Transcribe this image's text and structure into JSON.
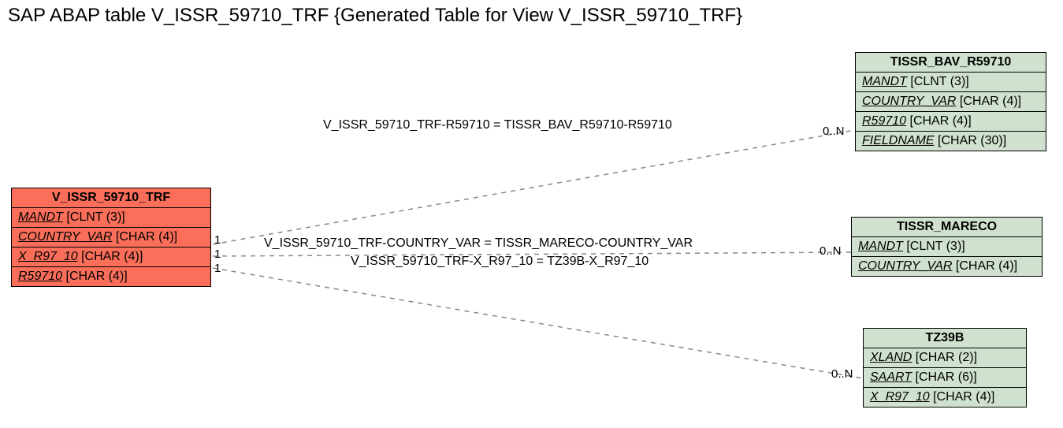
{
  "title": "SAP ABAP table V_ISSR_59710_TRF {Generated Table for View V_ISSR_59710_TRF}",
  "entities": {
    "main": {
      "name": "V_ISSR_59710_TRF",
      "fields": [
        {
          "key": "MANDT",
          "type": " [CLNT (3)]"
        },
        {
          "key": "COUNTRY_VAR",
          "type": " [CHAR (4)]"
        },
        {
          "key": "X_R97_10",
          "type": " [CHAR (4)]"
        },
        {
          "key": "R59710",
          "type": " [CHAR (4)]"
        }
      ]
    },
    "e1": {
      "name": "TISSR_BAV_R59710",
      "fields": [
        {
          "key": "MANDT",
          "type": " [CLNT (3)]"
        },
        {
          "key": "COUNTRY_VAR",
          "type": " [CHAR (4)]"
        },
        {
          "key": "R59710",
          "type": " [CHAR (4)]"
        },
        {
          "key": "FIELDNAME",
          "type": " [CHAR (30)]"
        }
      ]
    },
    "e2": {
      "name": "TISSR_MARECO",
      "fields": [
        {
          "key": "MANDT",
          "type": " [CLNT (3)]"
        },
        {
          "key": "COUNTRY_VAR",
          "type": " [CHAR (4)]"
        }
      ]
    },
    "e3": {
      "name": "TZ39B",
      "fields": [
        {
          "key": "XLAND",
          "type": " [CHAR (2)]"
        },
        {
          "key": "SAART",
          "type": " [CHAR (6)]"
        },
        {
          "key": "X_R97_10",
          "type": " [CHAR (4)]"
        }
      ]
    }
  },
  "relations": {
    "r1": "V_ISSR_59710_TRF-R59710 = TISSR_BAV_R59710-R59710",
    "r2": "V_ISSR_59710_TRF-COUNTRY_VAR = TISSR_MARECO-COUNTRY_VAR",
    "r3": "V_ISSR_59710_TRF-X_R97_10 = TZ39B-X_R97_10"
  },
  "card": {
    "left1": "1",
    "left2": "1",
    "left3": "1",
    "right1": "0..N",
    "right2": "0..N",
    "right3": "0..N"
  }
}
